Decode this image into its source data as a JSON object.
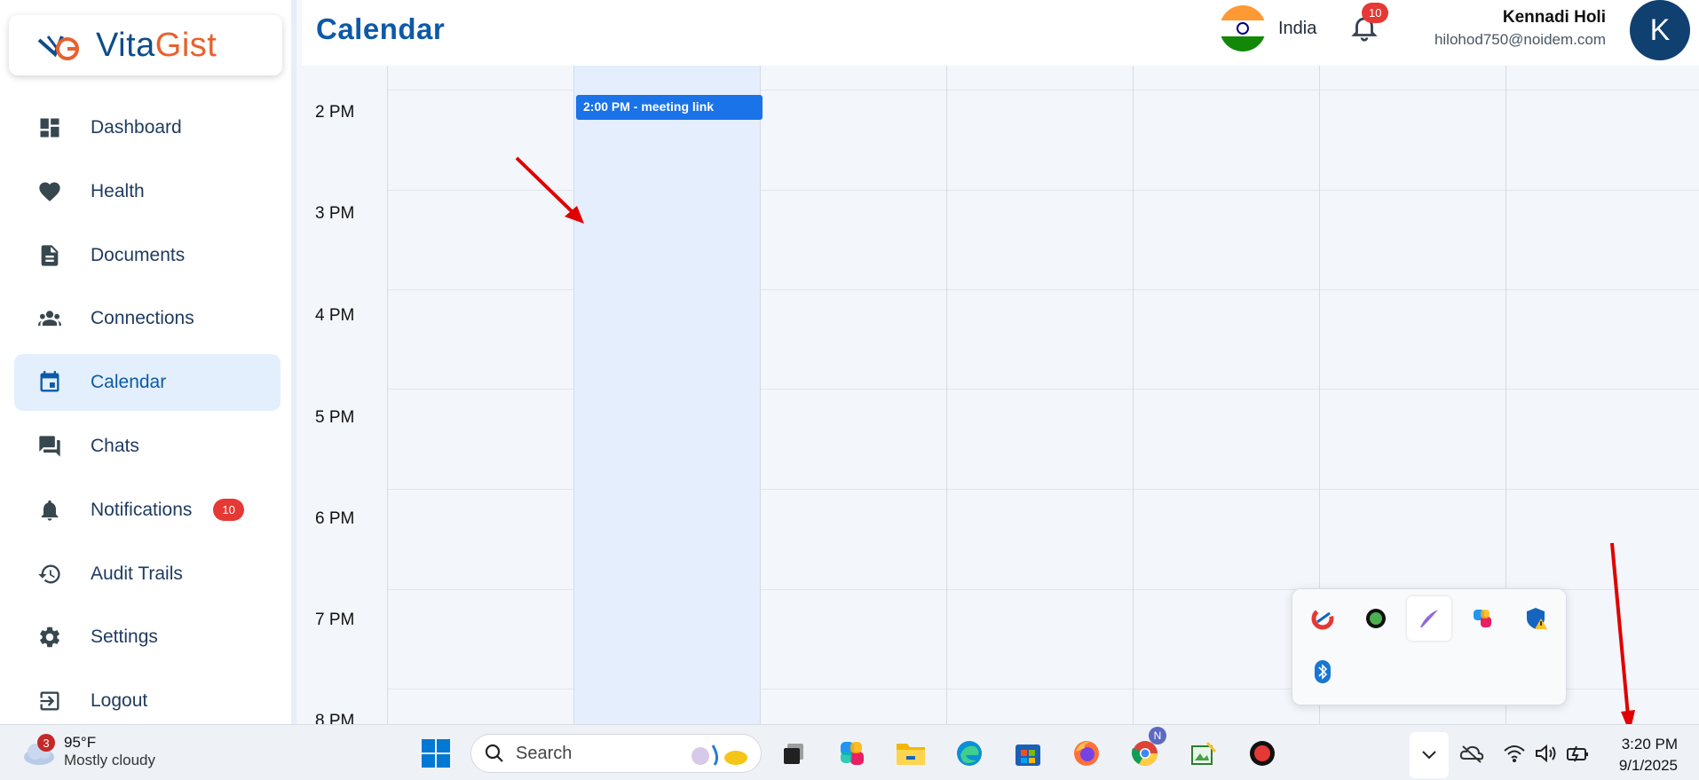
{
  "brand": {
    "part1": "Vita",
    "part2": "Gist"
  },
  "sidebar": {
    "items": [
      {
        "label": "Dashboard",
        "icon": "dashboard-icon"
      },
      {
        "label": "Health",
        "icon": "heart-icon"
      },
      {
        "label": "Documents",
        "icon": "document-icon"
      },
      {
        "label": "Connections",
        "icon": "people-icon"
      },
      {
        "label": "Calendar",
        "icon": "calendar-icon",
        "active": true
      },
      {
        "label": "Chats",
        "icon": "chat-icon"
      },
      {
        "label": "Notifications",
        "icon": "bell-icon",
        "badge": "10"
      },
      {
        "label": "Audit Trails",
        "icon": "history-icon"
      },
      {
        "label": "Settings",
        "icon": "gear-icon"
      },
      {
        "label": "Logout",
        "icon": "logout-icon"
      }
    ]
  },
  "header": {
    "title": "Calendar",
    "country": "India",
    "notification_count": "10",
    "user_name": "Kennadi Holi",
    "user_email": "hilohod750@noidem.com",
    "avatar_letter": "K"
  },
  "calendar": {
    "hours": [
      "2 PM",
      "3 PM",
      "4 PM",
      "5 PM",
      "6 PM",
      "7 PM",
      "8 PM"
    ],
    "event": {
      "label": "2:00 PM - meeting link",
      "color": "#1a73e8"
    }
  },
  "taskbar": {
    "weather_temp": "95°F",
    "weather_desc": "Mostly cloudy",
    "weather_badge": "3",
    "search_label": "Search",
    "chrome_badge": "N",
    "time": "3:20 PM",
    "date": "9/1/2025"
  },
  "colors": {
    "accent": "#0d5aa7",
    "brand_orange": "#e8612c",
    "badge_red": "#e53935",
    "arrow_red": "#e00000"
  }
}
